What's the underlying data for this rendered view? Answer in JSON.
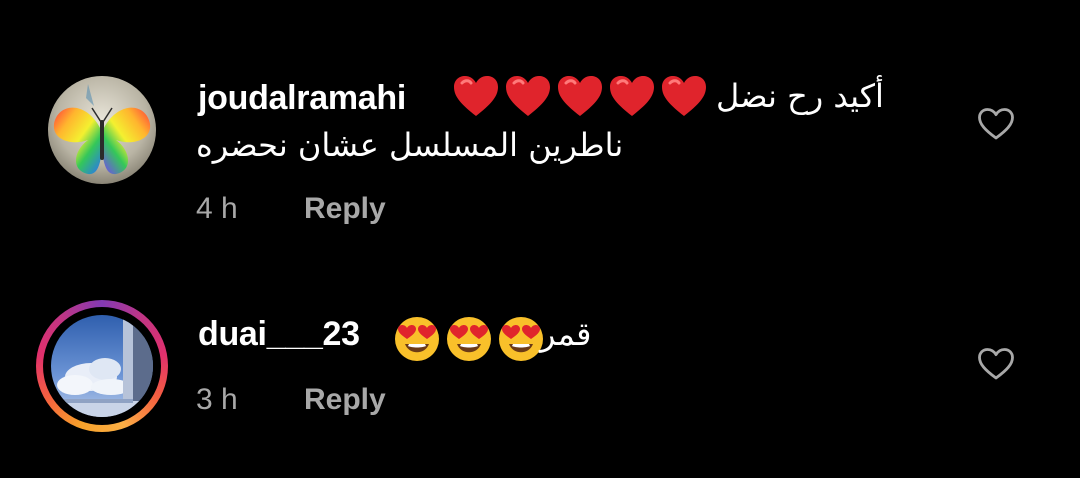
{
  "comments": [
    {
      "username": "joudalramahi",
      "text_line1": "أكيد رح نضل",
      "text_line2": "ناطرين المسلسل عشان نحضره",
      "emoji_name": "red-heart",
      "emoji_count": 5,
      "time": "4 h",
      "reply_label": "Reply",
      "has_story_ring": false,
      "avatar_icon": "rainbow-butterfly-avatar",
      "like_icon": "heart-outline-icon"
    },
    {
      "username": "duai___23",
      "text": "قمر",
      "emoji_name": "heart-eyes",
      "emoji_count": 3,
      "time": "3 h",
      "reply_label": "Reply",
      "has_story_ring": true,
      "avatar_icon": "window-sky-avatar",
      "like_icon": "heart-outline-icon"
    }
  ],
  "colors": {
    "background": "#000000",
    "text_primary": "#ffffff",
    "text_secondary": "#a8a8a8",
    "heart_red": "#e0242c",
    "emoji_yellow": "#f9c02a",
    "story_gradient": [
      "#fcaf45",
      "#f56040",
      "#e1306c",
      "#c13584",
      "#833ab4"
    ]
  }
}
